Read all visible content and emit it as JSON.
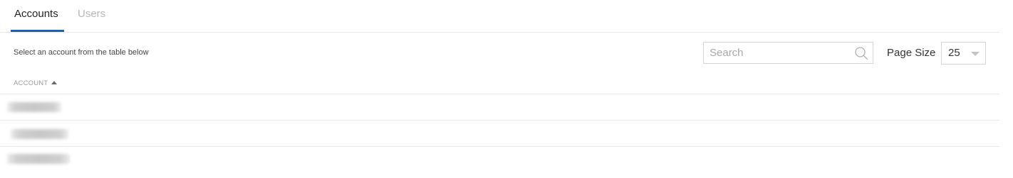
{
  "tabs": [
    {
      "label": "Accounts",
      "active": true
    },
    {
      "label": "Users",
      "active": false
    }
  ],
  "instruction": "Select an account from the table below",
  "search": {
    "placeholder": "Search",
    "value": ""
  },
  "page_size": {
    "label": "Page Size",
    "value": "25"
  },
  "table": {
    "columns": [
      {
        "label": "ACCOUNT",
        "sort": "ascending"
      }
    ],
    "rows": [
      {
        "account": "",
        "redacted": true
      },
      {
        "account": "",
        "redacted": true
      },
      {
        "account": "",
        "redacted": true
      }
    ]
  },
  "colors": {
    "accent": "#1f5fae",
    "inactive_tab": "#b7b7b7",
    "divider": "#e6e6e6"
  }
}
